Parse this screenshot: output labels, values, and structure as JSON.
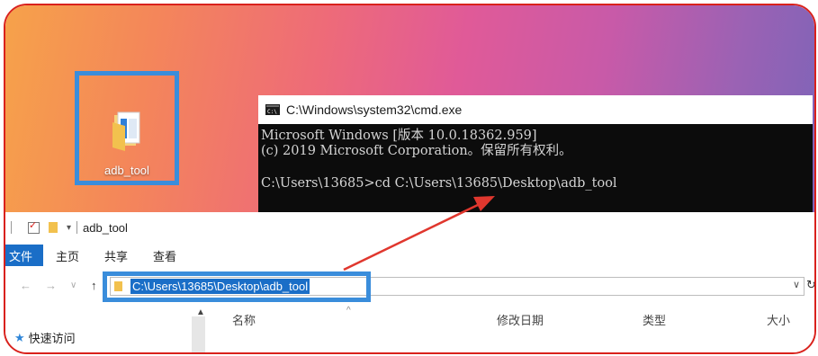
{
  "desktop": {
    "folder_label": "adb_tool"
  },
  "cmd": {
    "title": "C:\\Windows\\system32\\cmd.exe",
    "lines": [
      "Microsoft Windows [版本 10.0.18362.959]",
      "(c) 2019 Microsoft Corporation。保留所有权利。",
      "",
      "C:\\Users\\13685>cd C:\\Users\\13685\\Desktop\\adb_tool"
    ]
  },
  "explorer": {
    "window_title": "adb_tool",
    "tabs": [
      "文件",
      "主页",
      "共享",
      "查看"
    ],
    "nav": {
      "back": "←",
      "forward": "→",
      "recent": "∨",
      "up": "↑"
    },
    "address": "C:\\Users\\13685\\Desktop\\adb_tool",
    "refresh": "↻",
    "sidebar": {
      "quick_access": "快速访问"
    },
    "columns": [
      "名称",
      "修改日期",
      "类型",
      "大小"
    ]
  },
  "colors": {
    "highlight_box": "#3a8ddb",
    "annotation_red": "#d9211c",
    "selection_blue": "#1a6ec7"
  }
}
